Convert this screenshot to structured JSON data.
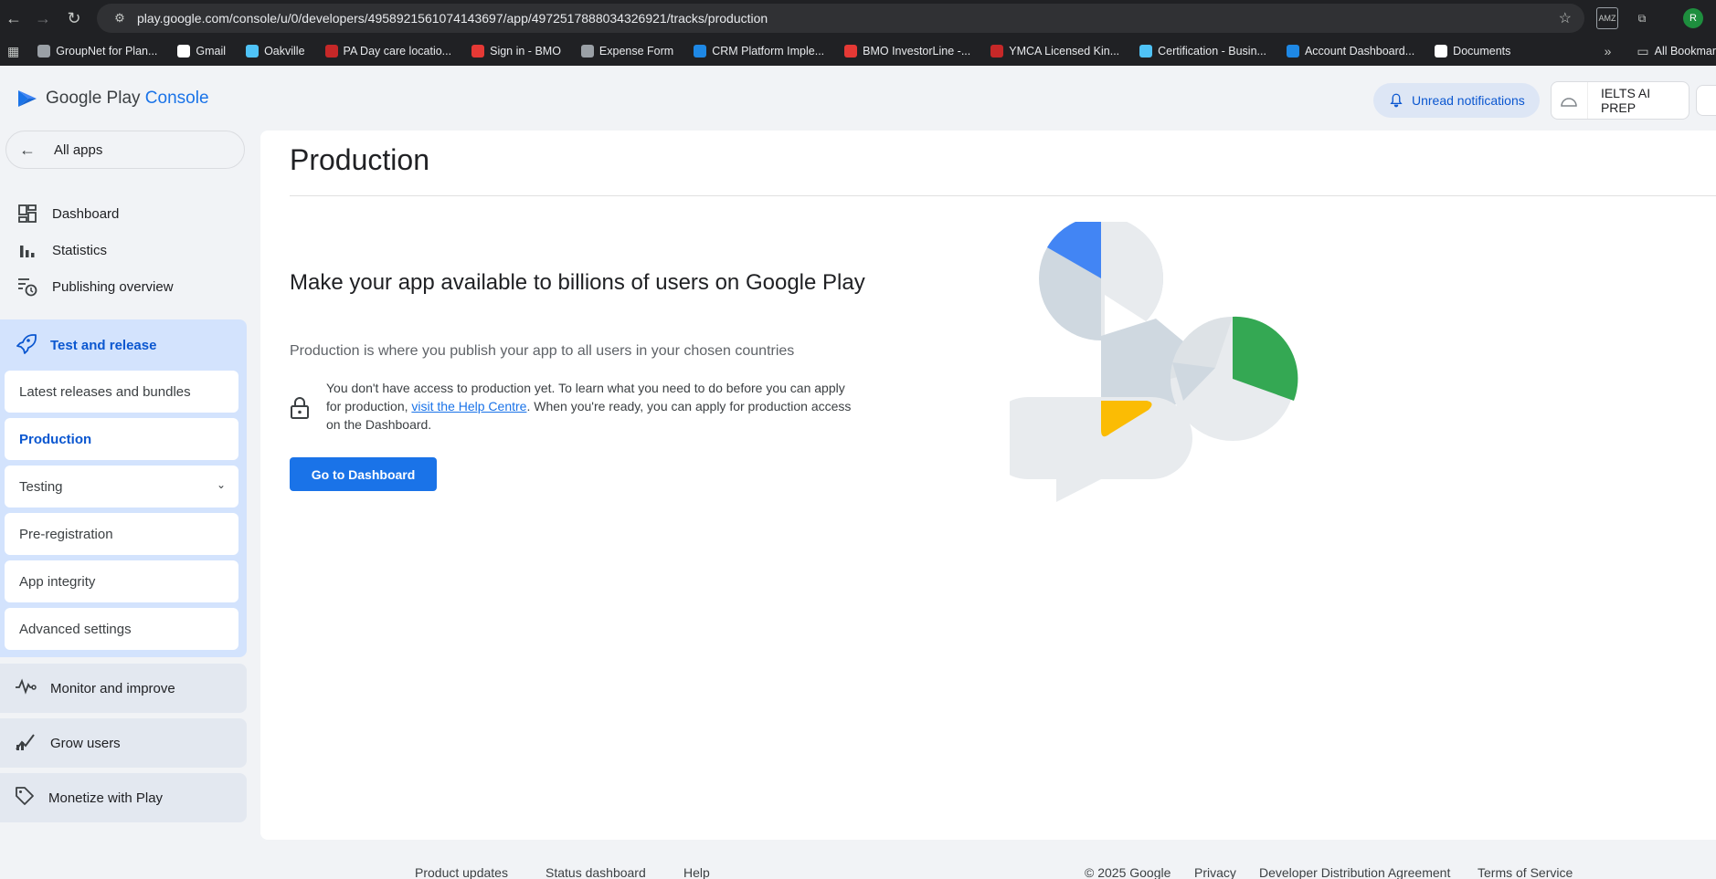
{
  "browser": {
    "url": "play.google.com/console/u/0/developers/4958921561074143697/app/4972517888034326921/tracks/production",
    "bookmarks": [
      {
        "label": "GroupNet for Plan...",
        "color": "#9aa0a6"
      },
      {
        "label": "Gmail",
        "color": "#ffffff"
      },
      {
        "label": "Oakville",
        "color": "#4fc3f7"
      },
      {
        "label": "PA Day care locatio...",
        "color": "#c62828"
      },
      {
        "label": "Sign in - BMO",
        "color": "#e53935"
      },
      {
        "label": "Expense Form",
        "color": "#9aa0a6"
      },
      {
        "label": "CRM Platform Imple...",
        "color": "#1e88e5"
      },
      {
        "label": "BMO InvestorLine -...",
        "color": "#e53935"
      },
      {
        "label": "YMCA Licensed Kin...",
        "color": "#c62828"
      },
      {
        "label": "Certification - Busin...",
        "color": "#4fc3f7"
      },
      {
        "label": "Account Dashboard...",
        "color": "#1e88e5"
      },
      {
        "label": "Documents",
        "color": "#ffffff"
      }
    ],
    "all_bookmarks": "All Bookmar",
    "profile_initial": "R"
  },
  "header": {
    "logo_google_play": "Google Play",
    "logo_console": "Console",
    "notifications": "Unread notifications",
    "app_name": "IELTS AI PREP"
  },
  "sidebar": {
    "all_apps": "All apps",
    "items": [
      {
        "label": "Dashboard"
      },
      {
        "label": "Statistics"
      },
      {
        "label": "Publishing overview"
      }
    ],
    "test_release": {
      "label": "Test and release",
      "children": [
        {
          "label": "Latest releases and bundles"
        },
        {
          "label": "Production"
        },
        {
          "label": "Testing"
        },
        {
          "label": "Pre-registration"
        },
        {
          "label": "App integrity"
        },
        {
          "label": "Advanced settings"
        }
      ]
    },
    "groups": [
      {
        "label": "Monitor and improve"
      },
      {
        "label": "Grow users"
      },
      {
        "label": "Monetize with Play"
      }
    ]
  },
  "main": {
    "title": "Production",
    "headline": "Make your app available to billions of users on Google Play",
    "subhead": "Production is where you publish your app to all users in your chosen countries",
    "note_pre": "You don't have access to production yet. To learn what you need to do before you can apply for production, ",
    "note_link": "visit the Help Centre",
    "note_post": ". When you're ready, you can apply for production access on the Dashboard.",
    "cta": "Go to Dashboard"
  },
  "footer": {
    "left": [
      "Product updates",
      "Status dashboard",
      "Help"
    ],
    "right": [
      "© 2025 Google",
      "Privacy",
      "Developer Distribution Agreement",
      "Terms of Service"
    ]
  },
  "colors": {
    "accent": "#1a73e8",
    "nav_active_bg": "#d3e3fd",
    "illus_blue": "#4285f4",
    "illus_green": "#34a853",
    "illus_yellow": "#fbbc04"
  }
}
